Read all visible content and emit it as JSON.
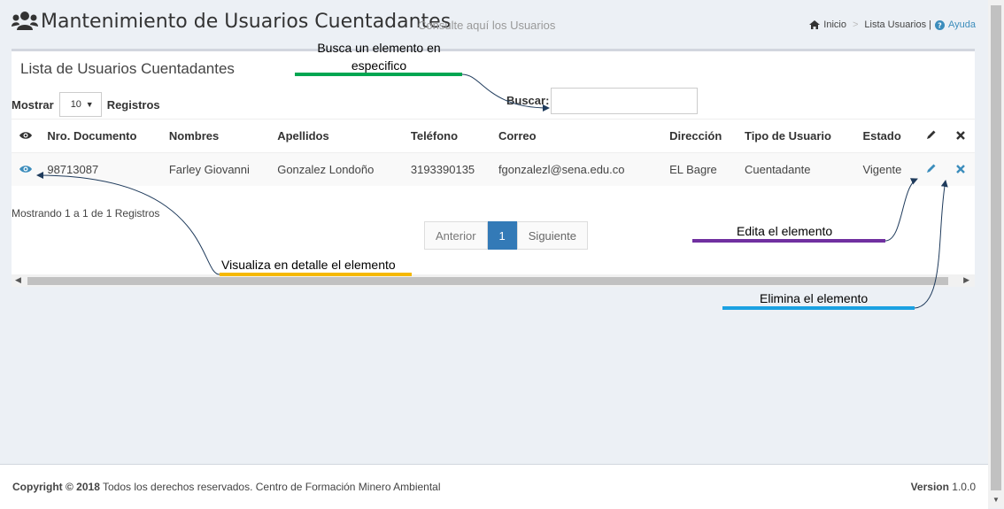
{
  "header": {
    "title": "Mantenimiento de Usuarios Cuentadantes",
    "subtitle": "Consulte aquí los Usuarios",
    "title_icon": "users-icon"
  },
  "breadcrumb": {
    "home_icon": "home-icon",
    "home": "Inicio",
    "separator": ">",
    "current": "Lista Usuarios |",
    "help_icon": "question-circle-icon",
    "help": "Ayuda"
  },
  "box": {
    "title": "Lista de Usuarios Cuentadantes",
    "show_label": "Mostrar",
    "page_size": "10",
    "records_label": "Registros",
    "search_label": "Buscar:",
    "search_value": ""
  },
  "table": {
    "columns": [
      "Nro. Documento",
      "Nombres",
      "Apellidos",
      "Teléfono",
      "Correo",
      "Dirección",
      "Tipo de Usuario",
      "Estado"
    ],
    "column_icons": [
      "eye-icon",
      "pencil-icon",
      "close-icon"
    ],
    "rows": [
      [
        "98713087",
        "Farley Giovanni",
        "Gonzalez Londoño",
        "3193390135",
        "fgonzalezl@sena.edu.co",
        "EL Bagre",
        "Cuentadante",
        "Vigente"
      ]
    ]
  },
  "info": "Mostrando 1 a 1 de 1 Registros",
  "pagination": {
    "prev": "Anterior",
    "current": "1",
    "next": "Siguiente"
  },
  "footer": {
    "copyright_bold": "Copyright © 2018",
    "copyright_text": "Todos los derechos reservados. Centro de Formación Minero Ambiental",
    "version_label": "Version",
    "version_value": "1.0.0"
  },
  "annotations": {
    "search": "Busca un elemento en\nespecifico",
    "view": "Visualiza en detalle el elemento",
    "edit": "Edita el elemento",
    "delete": "Elimina el elemento"
  },
  "colors": {
    "accent": "#3c8dbc",
    "active_page": "#337ab7",
    "line_green": "#00a651",
    "line_yellow": "#f5b800",
    "line_purple": "#7030a0",
    "line_blue": "#1ba1e2"
  }
}
